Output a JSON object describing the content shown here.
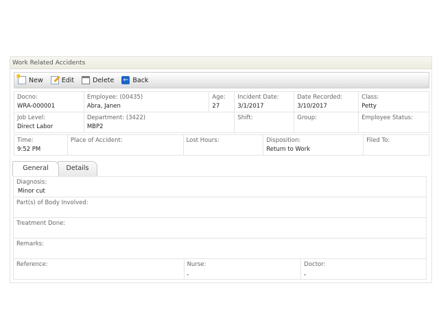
{
  "panel": {
    "title": "Work Related Accidents"
  },
  "toolbar": {
    "new_label": "New",
    "edit_label": "Edit",
    "delete_label": "Delete",
    "back_label": "Back"
  },
  "icons": {
    "new": "new-document-icon",
    "edit": "edit-icon",
    "delete": "delete-icon",
    "back": "back-arrow-icon",
    "back_color": "#1c66c7"
  },
  "header": {
    "docno": {
      "label": "Docno:",
      "value": "WRA-000001"
    },
    "employee": {
      "label": "Employee: (00435)",
      "value": "Abra, Janen"
    },
    "age": {
      "label": "Age:",
      "value": "27"
    },
    "incident_date": {
      "label": "Incident Date:",
      "value": "3/1/2017"
    },
    "date_recorded": {
      "label": "Date Recorded:",
      "value": "3/10/2017"
    },
    "class": {
      "label": "Class:",
      "value": "Petty"
    },
    "job_level": {
      "label": "Job Level:",
      "value": "Direct Labor"
    },
    "department": {
      "label": "Department: (3422)",
      "value": "MBP2"
    },
    "shift": {
      "label": "Shift:",
      "value": ""
    },
    "group": {
      "label": "Group:",
      "value": ""
    },
    "employee_status": {
      "label": "Employee Status:",
      "value": ""
    }
  },
  "accident": {
    "time": {
      "label": "Time:",
      "value": "9:52 PM"
    },
    "place": {
      "label": "Place of Accident:",
      "value": ""
    },
    "lost_hours": {
      "label": "Lost Hours:",
      "value": ""
    },
    "disposition": {
      "label": "Disposition:",
      "value": "Return to Work"
    },
    "filed_to": {
      "label": "Filed To:",
      "value": ""
    }
  },
  "tabs": {
    "general": "General",
    "details": "Details"
  },
  "general": {
    "diagnosis": {
      "label": "Diagnosis:",
      "value": "Minor cut"
    },
    "body_parts": {
      "label": "Part(s) of Body Involved:",
      "value": ""
    },
    "treatment": {
      "label": "Treatment Done:",
      "value": ""
    },
    "remarks": {
      "label": "Remarks:",
      "value": ""
    },
    "reference": {
      "label": "Reference:",
      "value": ""
    },
    "nurse": {
      "label": "Nurse:",
      "value": ","
    },
    "doctor": {
      "label": "Doctor:",
      "value": ","
    }
  }
}
